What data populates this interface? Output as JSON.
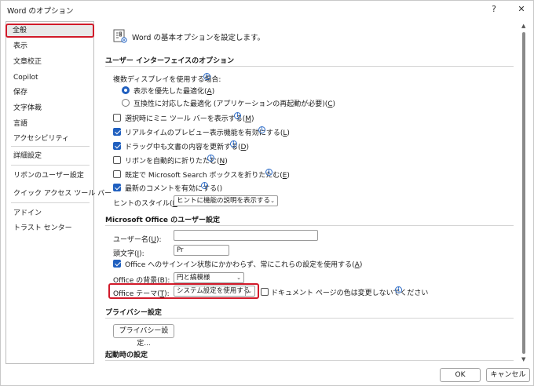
{
  "window": {
    "title": "Word のオプション",
    "help": "?",
    "close": "✕"
  },
  "sidebar": {
    "items": [
      {
        "label": "全般"
      },
      {
        "label": "表示"
      },
      {
        "label": "文章校正"
      },
      {
        "label": "Copilot"
      },
      {
        "label": "保存"
      },
      {
        "label": "文字体裁"
      },
      {
        "label": "言語"
      },
      {
        "label": "アクセシビリティ"
      },
      {
        "label": "詳細設定"
      },
      {
        "label": "リボンのユーザー設定"
      },
      {
        "label": "クイック アクセス ツール バー"
      },
      {
        "label": "アドイン"
      },
      {
        "label": "トラスト センター"
      }
    ],
    "active_index": 0
  },
  "header": {
    "text": "Word の基本オプションを設定します。"
  },
  "ui_section": {
    "title": "ユーザー インターフェイスのオプション",
    "multi_display_label": "複数ディスプレイを使用する場合:",
    "radio_optimize_display": "表示を優先した最適化(",
    "radio_optimize_display_key": "A",
    "radio_compat": "互換性に対応した最適化 (アプリケーションの再起動が必要)(",
    "radio_compat_key": "C",
    "close_paren": ")",
    "mini_toolbar": {
      "text": "選択時にミニ ツール バーを表示する(",
      "key": "M",
      "checked": false
    },
    "live_preview": {
      "text": "リアルタイムのプレビュー表示機能を有効にする(",
      "key": "L",
      "checked": true
    },
    "update_drag": {
      "text": "ドラッグ中も文書の内容を更新する(",
      "key": "D",
      "checked": true
    },
    "collapse_ribbon": {
      "text": "リボンを自動的に折りたたむ(",
      "key": "N",
      "checked": false
    },
    "collapse_search": {
      "text": "既定で Microsoft Search ボックスを折りたたむ(",
      "key": "E",
      "checked": false
    },
    "modern_comments": {
      "text": "最新のコメントを有効にする(",
      "key": "",
      "checked": true
    },
    "hint_style_label": "ヒントのスタイル(",
    "hint_style_key": "R",
    "hint_style_suffix": "):",
    "hint_style_value": "ヒントに機能の説明を表示する"
  },
  "office_section": {
    "title": "Microsoft Office のユーザー設定",
    "username_label": "ユーザー名(",
    "username_key": "U",
    "username_suffix": "):",
    "username_value": "",
    "initials_label": "頭文字(",
    "initials_key": "I",
    "initials_suffix": "):",
    "initials_value": "Pr",
    "always_use": {
      "text": "Office へのサインイン状態にかかわらず、常にこれらの設定を使用する(",
      "key": "A",
      "checked": true
    },
    "background_label": "Office の背景(",
    "background_key": "B",
    "background_suffix": "):",
    "background_value": "円と縞模様",
    "theme_label": "Office テーマ(",
    "theme_key": "T",
    "theme_suffix": "):",
    "theme_value": "システム設定を使用する",
    "no_change_page_color": {
      "text": "ドキュメント ページの色は変更しないでください",
      "checked": false
    }
  },
  "privacy_section": {
    "title": "プライバシー設定",
    "button": "プライバシー設定..."
  },
  "startup_section": {
    "title": "起動時の設定"
  },
  "footer": {
    "ok": "OK",
    "cancel": "キャンセル"
  },
  "colors": {
    "accent": "#1f5fbf",
    "highlight": "#d11a2a"
  }
}
